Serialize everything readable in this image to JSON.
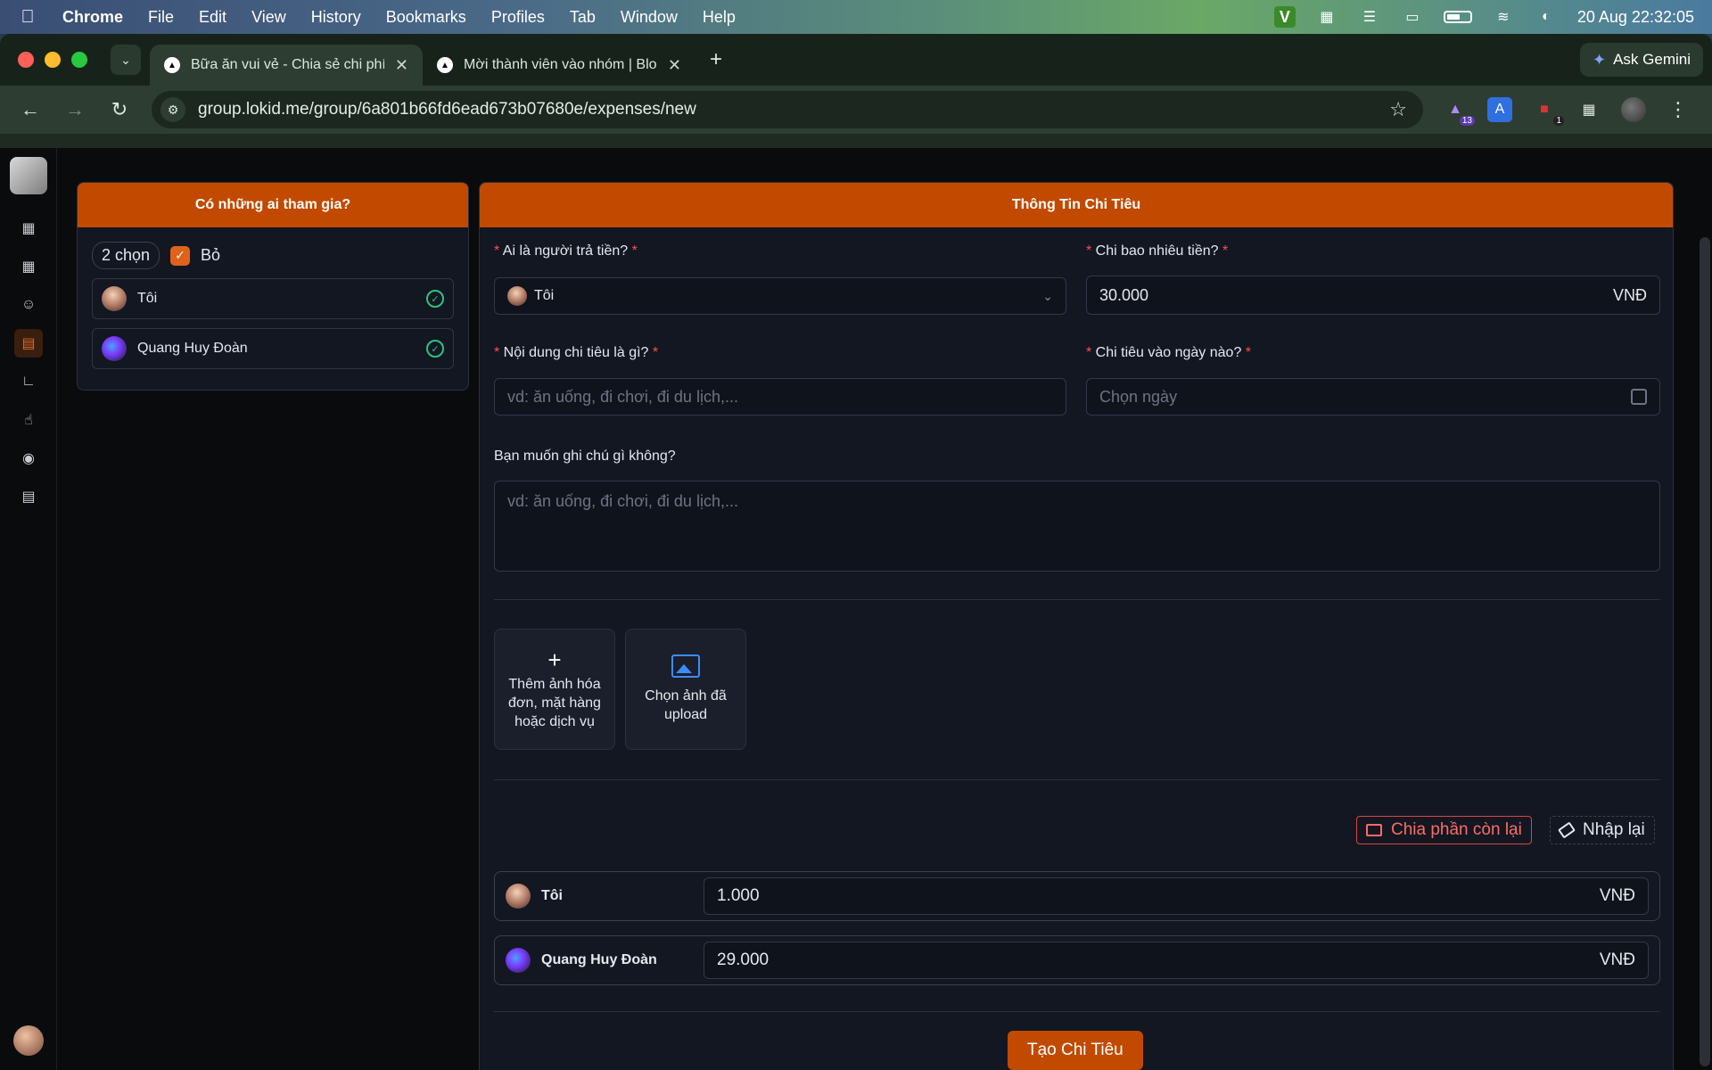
{
  "menubar": {
    "app": "Chrome",
    "items": [
      "File",
      "Edit",
      "View",
      "History",
      "Bookmarks",
      "Profiles",
      "Tab",
      "Window",
      "Help"
    ],
    "status_v": "V",
    "datetime": "20 Aug  22:32:05"
  },
  "browser": {
    "tabs": [
      {
        "title": "Bữa ăn vui vẻ - Chia sẻ chi phí",
        "active": true
      },
      {
        "title": "Mời thành viên vào nhóm | Blo",
        "active": false
      }
    ],
    "ask_gemini": "Ask Gemini",
    "url": "group.lokid.me/group/6a801b66fd6ead673b07680e/expenses/new",
    "ext_badge_1": "13",
    "ext_badge_2": "1"
  },
  "participants": {
    "header": "Có những ai tham gia?",
    "count": "2 chọn",
    "select_label": "Bỏ",
    "people": [
      {
        "name": "Tôi"
      },
      {
        "name": "Quang Huy Đoàn"
      }
    ]
  },
  "expense": {
    "header": "Thông Tin Chi Tiêu",
    "payer_label": "Ai là người trả tiền?",
    "payer_value": "Tôi",
    "amount_label": "Chi bao nhiêu tiền?",
    "amount_value": "30.000",
    "currency": "VNĐ",
    "content_label": "Nội dung chi tiêu là gì?",
    "content_placeholder": "vd: ăn uống, đi chơi, đi du lịch,...",
    "date_label": "Chi tiêu vào ngày nào?",
    "date_placeholder": "Chọn ngày",
    "note_label": "Bạn muốn ghi chú gì không?",
    "note_placeholder": "vd: ăn uống, đi chơi, đi du lịch,...",
    "upload_add": "Thêm ảnh hóa đơn, mặt hàng hoặc dịch vụ",
    "upload_choose": "Chọn ảnh đã upload",
    "split_remaining": "Chia phần còn lại",
    "reset": "Nhập lại",
    "splits": [
      {
        "name": "Tôi",
        "amount": "1.000"
      },
      {
        "name": "Quang Huy Đoàn",
        "amount": "29.000"
      }
    ],
    "submit": "Tạo Chi Tiêu"
  }
}
